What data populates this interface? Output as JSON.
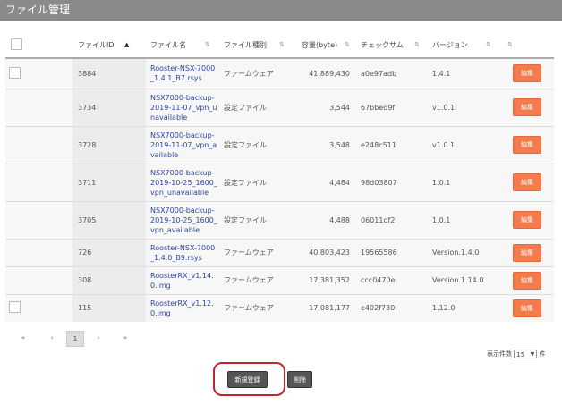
{
  "header": {
    "title": "ファイル管理"
  },
  "columns": {
    "id": "ファイルID",
    "name": "ファイル名",
    "type": "ファイル種別",
    "size": "容量(byte)",
    "checksum": "チェックサム",
    "version": "バージョン"
  },
  "rows": [
    {
      "id": "3884",
      "name_lines": [
        "Rooster-NSX-7000",
        "_1.4.1_B7.rsys"
      ],
      "type": "ファームウェア",
      "size": "41,889,430",
      "checksum": "a0e97adb",
      "version": "1.4.1",
      "edit": "編集"
    },
    {
      "id": "3734",
      "name_lines": [
        "NSX7000-backup-",
        "2019-11-07_vpn_u",
        "navailable"
      ],
      "type": "設定ファイル",
      "size": "3,544",
      "checksum": "67bbed9f",
      "version": "v1.0.1",
      "edit": "編集"
    },
    {
      "id": "3728",
      "name_lines": [
        "NSX7000-backup-",
        "2019-11-07_vpn_a",
        "vailable"
      ],
      "type": "設定ファイル",
      "size": "3,548",
      "checksum": "e248c511",
      "version": "v1.0.1",
      "edit": "編集"
    },
    {
      "id": "3711",
      "name_lines": [
        "NSX7000-backup-",
        "2019-10-25_1600_",
        "vpn_unavailable"
      ],
      "type": "設定ファイル",
      "size": "4,484",
      "checksum": "98d03807",
      "version": "1.0.1",
      "edit": "編集"
    },
    {
      "id": "3705",
      "name_lines": [
        "NSX7000-backup-",
        "2019-10-25_1600_",
        "vpn_available"
      ],
      "type": "設定ファイル",
      "size": "4,488",
      "checksum": "06011df2",
      "version": "1.0.1",
      "edit": "編集"
    },
    {
      "id": "726",
      "name_lines": [
        "Rooster-NSX-7000",
        "_1.4.0_B9.rsys"
      ],
      "type": "ファームウェア",
      "size": "40,803,423",
      "checksum": "19565586",
      "version": "Version.1.4.0",
      "edit": "編集"
    },
    {
      "id": "308",
      "name_lines": [
        "RoosterRX_v1.14.",
        "0.img"
      ],
      "type": "ファームウェア",
      "size": "17,381,352",
      "checksum": "ccc0470e",
      "version": "Version.1.14.0",
      "edit": "編集"
    },
    {
      "id": "115",
      "name_lines": [
        "RoosterRX_v1.12.",
        "0.img"
      ],
      "type": "ファームウェア",
      "size": "17,081,177",
      "checksum": "e402f730",
      "version": "1.12.0",
      "edit": "編集"
    }
  ],
  "pagination": {
    "first": "«",
    "prev": "‹",
    "current": "1",
    "next": "›",
    "last": "»"
  },
  "per_page": {
    "label": "表示件数",
    "value": "15",
    "unit": "件"
  },
  "buttons": {
    "new": "新規登録",
    "delete": "削除"
  },
  "colors": {
    "header_bg": "#8a8a8a",
    "edit_button": "#f47c4c",
    "highlight": "#c0252a",
    "link": "#2e46a6"
  }
}
